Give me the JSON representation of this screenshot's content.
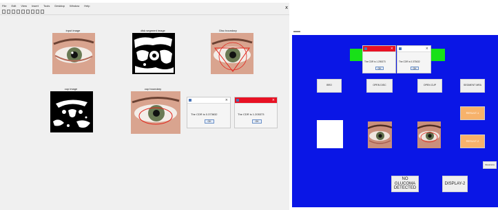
{
  "matlab": {
    "menu": [
      "File",
      "Edit",
      "View",
      "Insert",
      "Tools",
      "Desktop",
      "Window",
      "Help"
    ],
    "close_glyph": "x",
    "titles": {
      "input": "input image",
      "disk": "disk segment image",
      "disc_boundary": "Disc boundary",
      "cup": "cup image",
      "cup_boundary": "cup boundary"
    },
    "msg1": {
      "text": "The CDR is 0.373632",
      "ok": "OK"
    },
    "msg2": {
      "text": "The CDR is 1.205373",
      "ok": "OK"
    }
  },
  "gui": {
    "top_msg1": {
      "text": "The CDR is 1.205373",
      "ok": "OK"
    },
    "top_msg2": {
      "text": "The CDR is 0.373632",
      "ok": "OK"
    },
    "buttons": {
      "b1": "BRO",
      "b2": "OPEN DISC",
      "b3": "OPEN CUP",
      "b4": "SEGMENT MRA",
      "result1": "RESULT-1",
      "result2": "RESULT-2",
      "small_right": "Glaucoma",
      "diagnosis": "NO GLUCOMA DETECTED",
      "display2": "DISPLAY-2"
    }
  },
  "colors": {
    "gui_blue": "#0a16e6",
    "green": "#18e018",
    "orange": "#f7b26b",
    "title_red": "#e81123"
  }
}
